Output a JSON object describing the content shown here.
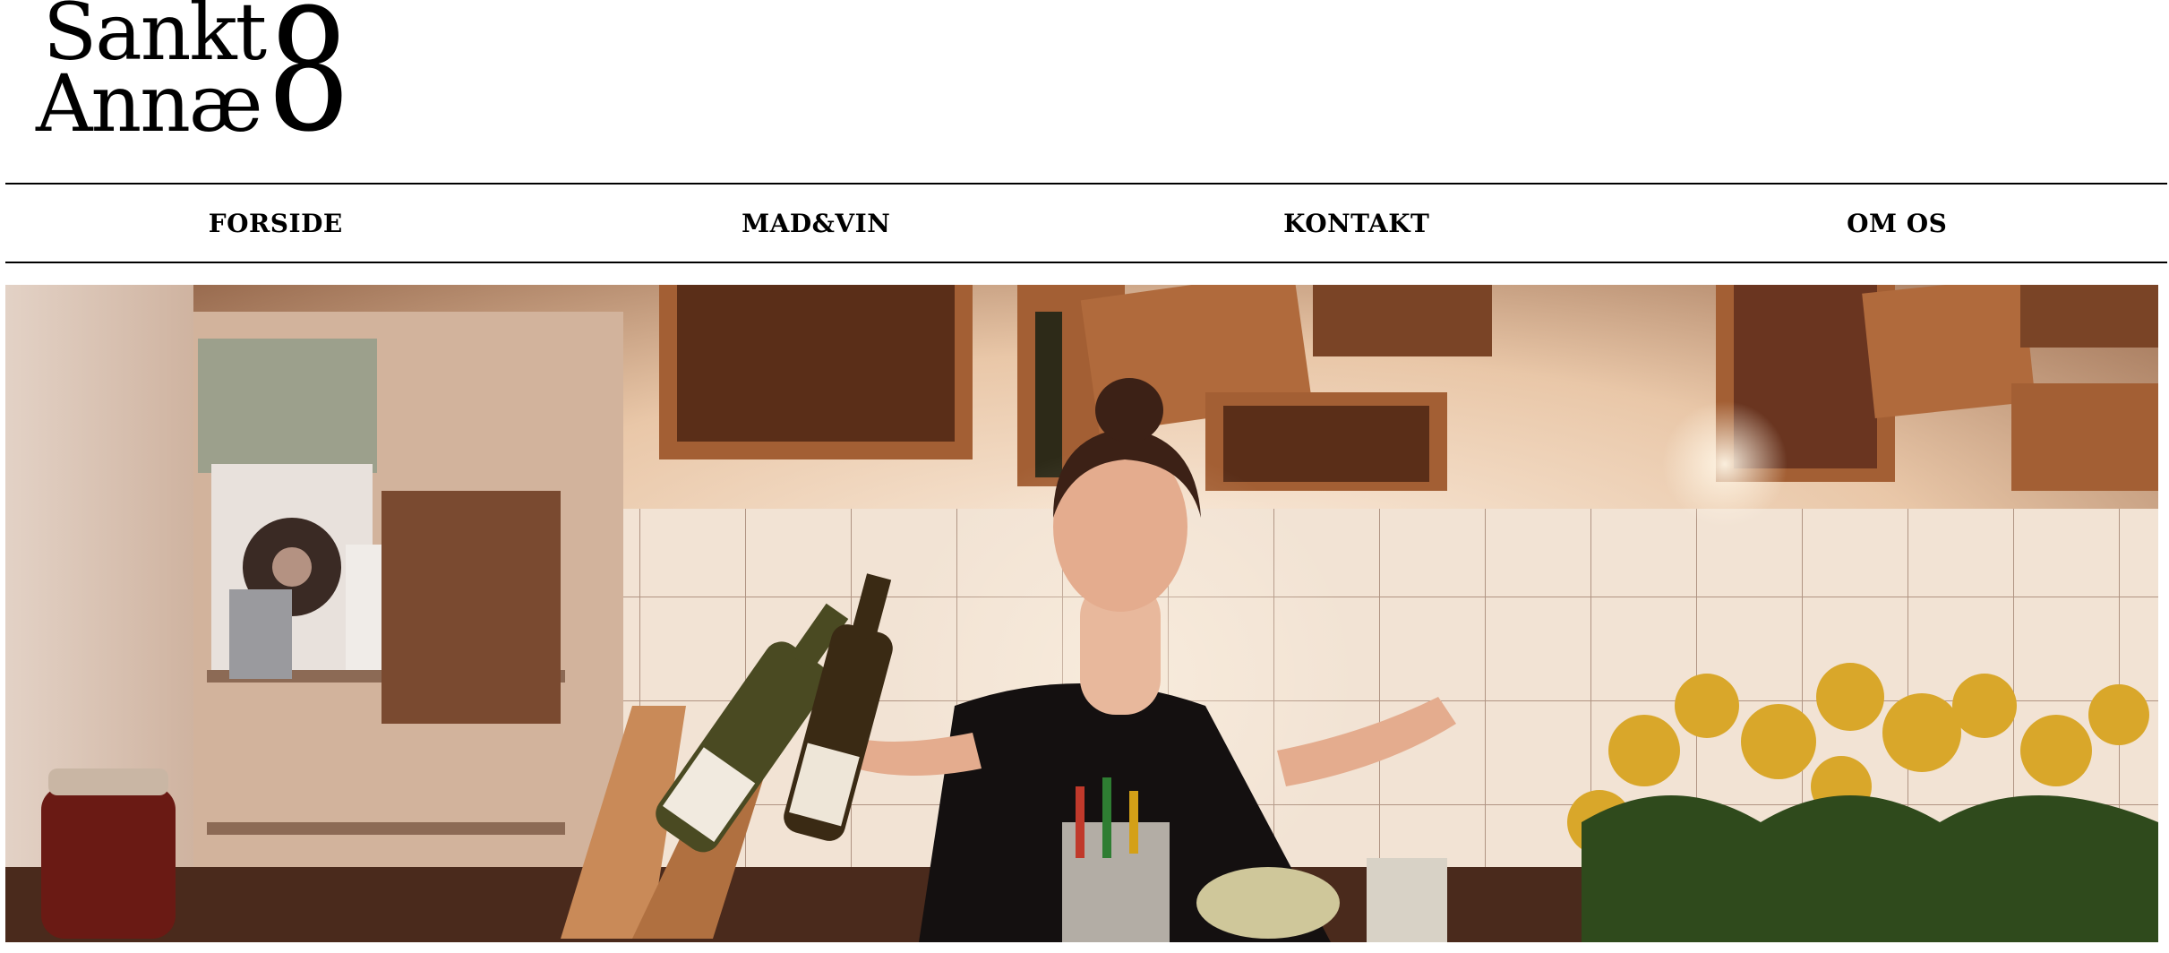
{
  "logo": {
    "line1": "Sankt",
    "line2": "Annæ",
    "number": "8"
  },
  "nav": {
    "items": [
      {
        "label": "FORSIDE"
      },
      {
        "label": "MAD&VIN"
      },
      {
        "label": "KONTAKT"
      },
      {
        "label": "OM OS"
      }
    ]
  },
  "hero": {
    "image_icon": "photo-kitchen-woman-wine"
  },
  "colors": {
    "background": "#ffffff",
    "text": "#000000",
    "rule": "#000000"
  }
}
